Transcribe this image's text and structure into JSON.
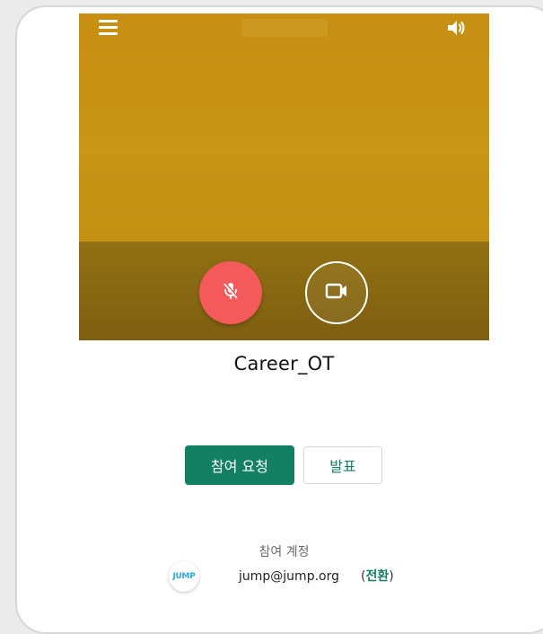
{
  "meeting": {
    "title": "Career_OT"
  },
  "actions": {
    "join_label": "참여 요청",
    "present_label": "발표"
  },
  "account": {
    "label": "참여 계정",
    "avatar_text": "JUMP",
    "email": "jump@jump.org",
    "switch_open": "(",
    "switch_label": "전환",
    "switch_close": ")"
  },
  "icons": {
    "menu": "menu-icon",
    "speaker": "speaker-icon",
    "mic": "mic-off-icon",
    "camera": "camera-icon"
  },
  "colors": {
    "accent": "#138063",
    "mic_off": "#f45a5a",
    "video_bg": "#c8920f"
  }
}
